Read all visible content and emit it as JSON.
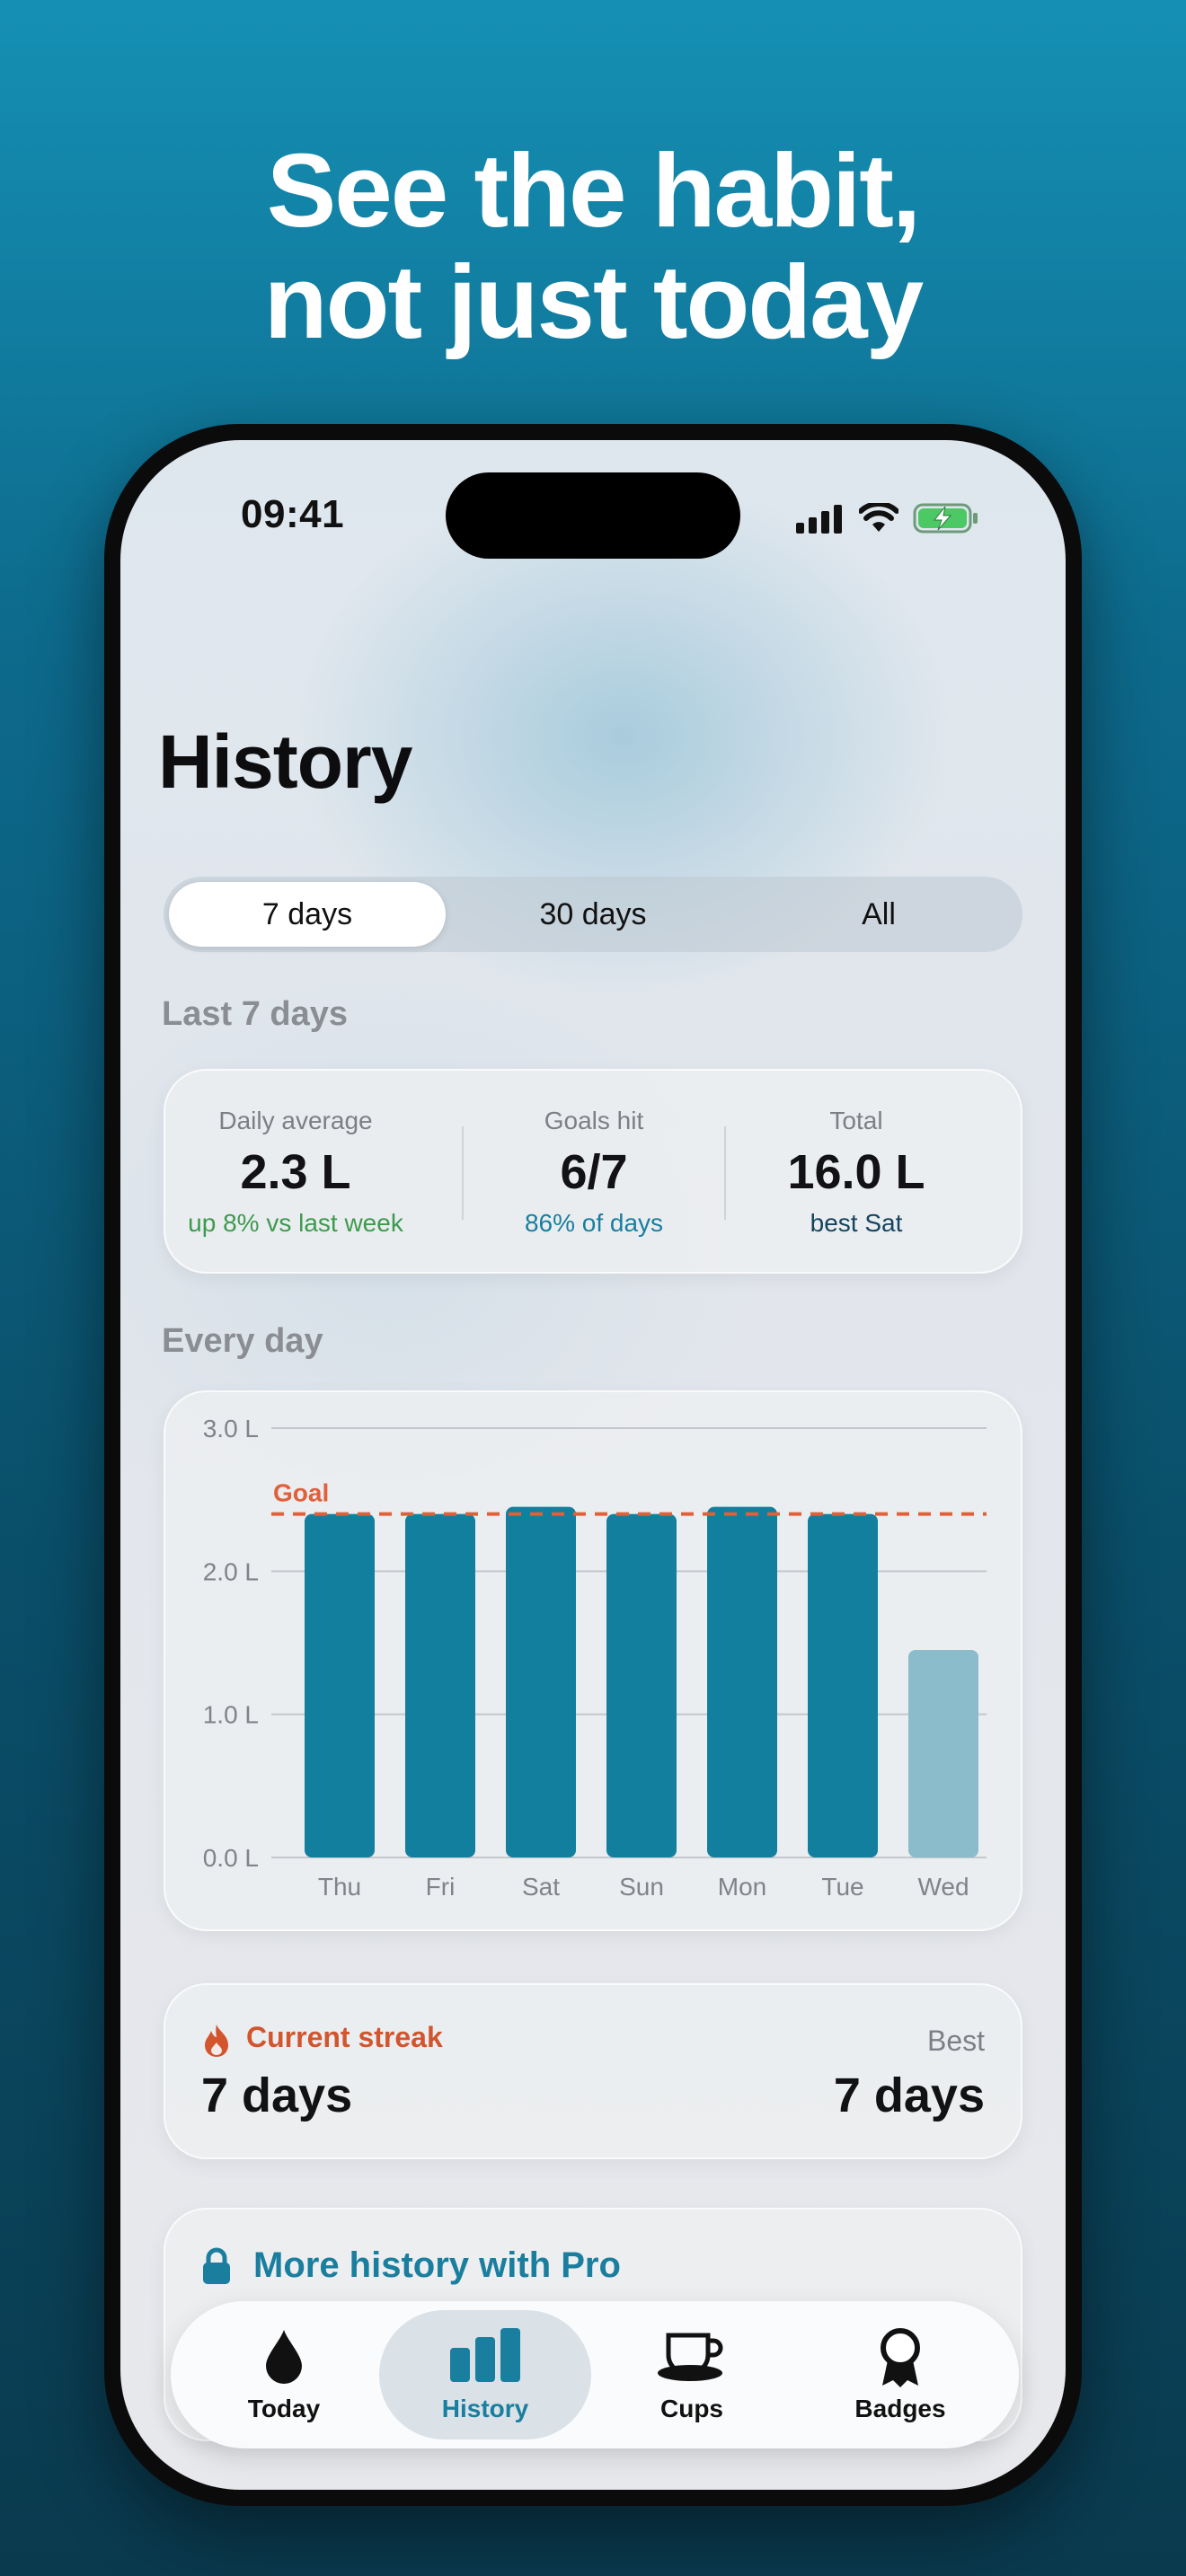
{
  "headline": {
    "line1": "See the habit,",
    "line2": "not just today"
  },
  "status_bar": {
    "time": "09:41",
    "icons": [
      "signal-icon",
      "wifi-icon",
      "battery-charging-icon"
    ]
  },
  "page": {
    "title": "History"
  },
  "range_selector": {
    "options": [
      "7 days",
      "30 days",
      "All"
    ],
    "selected": "7 days"
  },
  "summary": {
    "section_label": "Last 7 days",
    "stats": [
      {
        "label": "Daily average",
        "value": "2.3 L",
        "sub": "up 8% vs last week",
        "sub_color": "#3e9a4e"
      },
      {
        "label": "Goals hit",
        "value": "6/7",
        "sub": "86% of days",
        "sub_color": "#1a7e9e"
      },
      {
        "label": "Total",
        "value": "16.0 L",
        "sub": "best Sat",
        "sub_color": "#15445e"
      }
    ]
  },
  "daily": {
    "section_label": "Every day"
  },
  "chart_data": {
    "type": "bar",
    "categories": [
      "Thu",
      "Fri",
      "Sat",
      "Sun",
      "Mon",
      "Tue",
      "Wed"
    ],
    "values": [
      2.4,
      2.4,
      2.45,
      2.4,
      2.45,
      2.4,
      1.45
    ],
    "ylim": [
      0,
      3
    ],
    "yticks": [
      0,
      1,
      2,
      3
    ],
    "ytick_labels": [
      "0.0 L",
      "1.0 L",
      "2.0 L",
      "3.0 L"
    ],
    "goal": 2.4,
    "goal_label": "Goal",
    "grid": true,
    "colors": {
      "bar": "#137f9f",
      "bar_partial": "#8bbccb",
      "goal": "#e0603a"
    }
  },
  "streak": {
    "label": "Current streak",
    "value": "7 days",
    "best_label": "Best",
    "best_value": "7 days"
  },
  "pro_card": {
    "title": "More history with Pro"
  },
  "tabbar": {
    "tabs": [
      {
        "label": "Today",
        "icon": "water-drop-icon"
      },
      {
        "label": "History",
        "icon": "bar-chart-icon"
      },
      {
        "label": "Cups",
        "icon": "cup-icon"
      },
      {
        "label": "Badges",
        "icon": "badge-icon"
      }
    ],
    "active": "History"
  },
  "colors": {
    "accent": "#1a7e9e",
    "streak": "#d2552e"
  }
}
